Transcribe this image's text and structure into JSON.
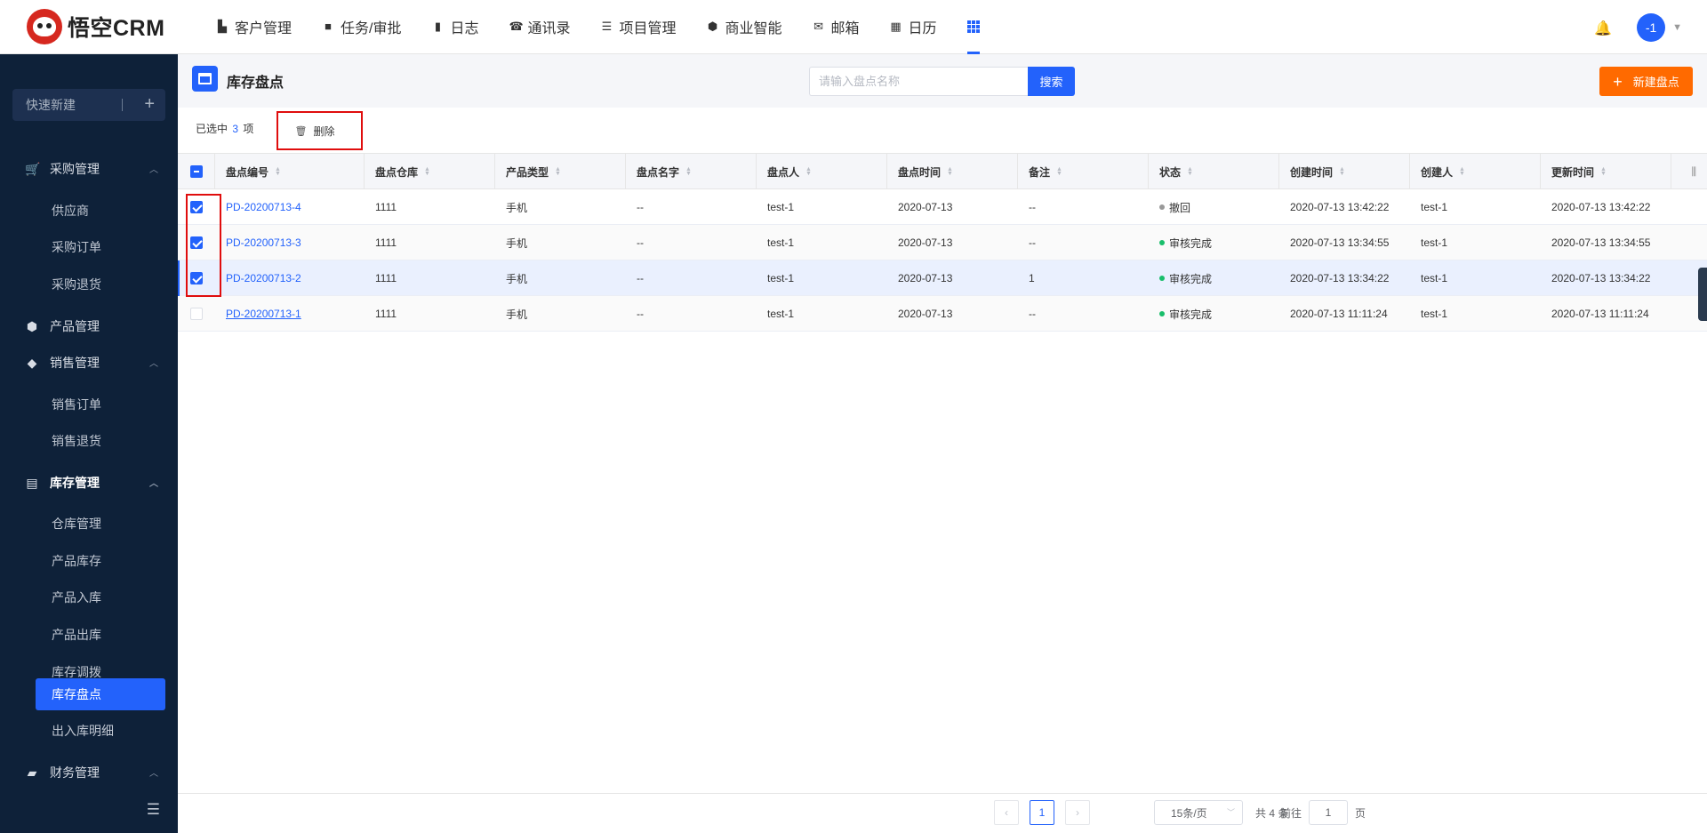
{
  "app": {
    "logo_text": "悟空CRM"
  },
  "nav": {
    "items": [
      {
        "label": "客户管理",
        "icon": "building-icon"
      },
      {
        "label": "任务/审批",
        "icon": "briefcase-icon"
      },
      {
        "label": "日志",
        "icon": "book-icon"
      },
      {
        "label": "通讯录",
        "icon": "phone-icon"
      },
      {
        "label": "项目管理",
        "icon": "list-icon"
      },
      {
        "label": "商业智能",
        "icon": "shield-icon"
      },
      {
        "label": "邮箱",
        "icon": "mail-icon"
      },
      {
        "label": "日历",
        "icon": "calendar-icon"
      }
    ],
    "active": "apps-grid-icon"
  },
  "user": {
    "avatar_text": "-1"
  },
  "sidebar": {
    "quick_new": "快速新建",
    "groups": {
      "purchase": {
        "label": "采购管理",
        "items": [
          "供应商",
          "采购订单",
          "采购退货"
        ]
      },
      "product": {
        "label": "产品管理"
      },
      "sales": {
        "label": "销售管理",
        "items": [
          "销售订单",
          "销售退货"
        ]
      },
      "inventory": {
        "label": "库存管理",
        "items": [
          "仓库管理",
          "产品库存",
          "产品入库",
          "产品出库",
          "库存调拨",
          "库存盘点",
          "出入库明细"
        ]
      },
      "finance": {
        "label": "财务管理"
      }
    },
    "active_item": "库存盘点"
  },
  "page": {
    "title": "库存盘点",
    "search_placeholder": "请输入盘点名称",
    "search_button": "搜索",
    "new_button": "新建盘点"
  },
  "toolbar": {
    "selected_prefix": "已选中",
    "selected_count": "3",
    "selected_suffix": "项",
    "delete_label": "删除"
  },
  "table": {
    "columns": [
      "盘点编号",
      "盘点仓库",
      "产品类型",
      "盘点名字",
      "盘点人",
      "盘点时间",
      "备注",
      "状态",
      "创建时间",
      "创建人",
      "更新时间"
    ],
    "rows": [
      {
        "checked": true,
        "code": "PD-20200713-4",
        "warehouse": "1111",
        "type": "手机",
        "name": "--",
        "checker": "test-1",
        "check_time": "2020-07-13",
        "remark": "--",
        "status": "撤回",
        "status_color": "#999999",
        "created": "2020-07-13 13:42:22",
        "creator": "test-1",
        "updated": "2020-07-13 13:42:22"
      },
      {
        "checked": true,
        "code": "PD-20200713-3",
        "warehouse": "1111",
        "type": "手机",
        "name": "--",
        "checker": "test-1",
        "check_time": "2020-07-13",
        "remark": "--",
        "status": "审核完成",
        "status_color": "#19be6b",
        "created": "2020-07-13 13:34:55",
        "creator": "test-1",
        "updated": "2020-07-13 13:34:55"
      },
      {
        "checked": true,
        "code": "PD-20200713-2",
        "warehouse": "1111",
        "type": "手机",
        "name": "--",
        "checker": "test-1",
        "check_time": "2020-07-13",
        "remark": "1",
        "status": "审核完成",
        "status_color": "#19be6b",
        "created": "2020-07-13 13:34:22",
        "creator": "test-1",
        "updated": "2020-07-13 13:34:22"
      },
      {
        "checked": false,
        "code": "PD-20200713-1",
        "warehouse": "1111",
        "type": "手机",
        "name": "--",
        "checker": "test-1",
        "check_time": "2020-07-13",
        "remark": "--",
        "status": "审核完成",
        "status_color": "#19be6b",
        "created": "2020-07-13 11:11:24",
        "creator": "test-1",
        "updated": "2020-07-13 11:11:24"
      }
    ]
  },
  "pager": {
    "current": "1",
    "page_size": "15条/页",
    "total": "共 4 条",
    "goto_prefix": "前往",
    "goto_value": "1",
    "goto_suffix": "页"
  },
  "colors": {
    "accent": "#2362fb",
    "orange": "#ff6a00",
    "sidebar_bg": "#0e2139",
    "highlight": "#e00d0d"
  }
}
